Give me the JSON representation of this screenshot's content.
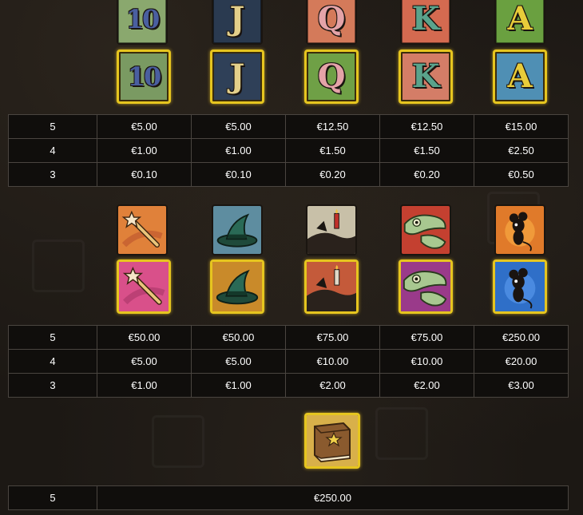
{
  "sections": [
    {
      "symbols": [
        {
          "id": "ten",
          "glyph": "10",
          "bg": "#7a9a62",
          "fg": "#4a5fa0"
        },
        {
          "id": "jack",
          "glyph": "J",
          "bg": "#2f4058",
          "fg": "#e3cf8a"
        },
        {
          "id": "queen",
          "glyph": "Q",
          "bg": "#6fa046",
          "fg": "#e4a3a8"
        },
        {
          "id": "king",
          "glyph": "K",
          "bg": "#d47d67",
          "fg": "#5aa38c"
        },
        {
          "id": "ace",
          "glyph": "A",
          "bg": "#4f8fb4",
          "fg": "#e8cc3a"
        }
      ],
      "rows": [
        {
          "count": "5",
          "values": [
            "€5.00",
            "€5.00",
            "€12.50",
            "€12.50",
            "€15.00"
          ]
        },
        {
          "count": "4",
          "values": [
            "€1.00",
            "€1.00",
            "€1.50",
            "€1.50",
            "€2.50"
          ]
        },
        {
          "count": "3",
          "values": [
            "€0.10",
            "€0.10",
            "€0.20",
            "€0.20",
            "€0.50"
          ]
        }
      ]
    },
    {
      "symbols": [
        {
          "id": "wand",
          "icon": "wand-icon",
          "bg": "#d9508a"
        },
        {
          "id": "hat",
          "icon": "witch-hat-icon",
          "bg": "#c98a2a"
        },
        {
          "id": "ravens",
          "icon": "ravens-candle-icon",
          "bg": "#c45a3a"
        },
        {
          "id": "frog",
          "icon": "frog-icon",
          "bg": "#9a3a8a"
        },
        {
          "id": "mouse",
          "icon": "mouse-icon",
          "bg": "#2f6fc8"
        }
      ],
      "rows": [
        {
          "count": "5",
          "values": [
            "€50.00",
            "€50.00",
            "€75.00",
            "€75.00",
            "€250.00"
          ]
        },
        {
          "count": "4",
          "values": [
            "€5.00",
            "€5.00",
            "€10.00",
            "€10.00",
            "€20.00"
          ]
        },
        {
          "count": "3",
          "values": [
            "€1.00",
            "€1.00",
            "€2.00",
            "€2.00",
            "€3.00"
          ]
        }
      ]
    },
    {
      "symbols": [
        {
          "id": "book",
          "icon": "spellbook-icon",
          "bg": "#d8b04a"
        }
      ],
      "rows": [
        {
          "count": "5",
          "value": "€250.00"
        }
      ]
    }
  ]
}
